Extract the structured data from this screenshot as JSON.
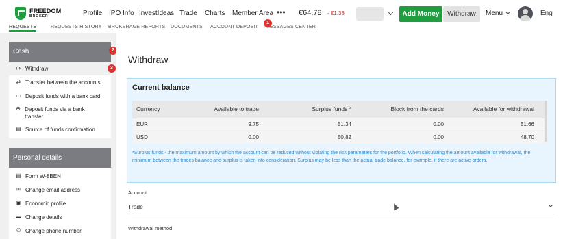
{
  "brand": {
    "name": "FREEDOM",
    "sub": "BROKER"
  },
  "nav": {
    "links": [
      "Profile",
      "IPO Info",
      "InvestIdeas",
      "Trade",
      "Charts",
      "Member Area"
    ],
    "more": "•••",
    "balance": "€64.78",
    "change": "- €1.38",
    "add_money": "Add Money",
    "withdraw": "Withdraw",
    "menu": "Menu",
    "lang": "Eng"
  },
  "badges": {
    "b1": "1",
    "b2": "2",
    "b3": "3"
  },
  "subtabs": [
    "REQUESTS",
    "REQUESTS HISTORY",
    "BROKERAGE REPORTS",
    "DOCUMENTS",
    "ACCOUNT DEPOSIT",
    "MESSAGES CENTER"
  ],
  "sidebar": {
    "cash": {
      "header": "Cash",
      "items": [
        {
          "label": "Withdraw",
          "icon": "withdraw-icon"
        },
        {
          "label": "Transfer between the accounts",
          "icon": "transfer-icon"
        },
        {
          "label": "Deposit funds with a bank card",
          "icon": "card-icon"
        },
        {
          "label": "Deposit funds via a bank transfer",
          "icon": "bank-transfer-icon"
        },
        {
          "label": "Source of funds confirmation",
          "icon": "document-icon"
        }
      ]
    },
    "personal": {
      "header": "Personal details",
      "items": [
        {
          "label": "Form W-8BEN",
          "icon": "form-icon"
        },
        {
          "label": "Change email address",
          "icon": "envelope-icon"
        },
        {
          "label": "Economic profile",
          "icon": "briefcase-icon"
        },
        {
          "label": "Change details",
          "icon": "folder-icon"
        },
        {
          "label": "Change phone number",
          "icon": "phone-icon"
        }
      ]
    }
  },
  "main": {
    "title": "Withdraw",
    "balance_box": {
      "title": "Current balance",
      "columns": [
        "Currency",
        "Available to trade",
        "Surplus funds *",
        "Block from the cards",
        "Available for withdrawal"
      ],
      "rows": [
        [
          "EUR",
          "9.75",
          "51.34",
          "0.00",
          "51.66"
        ],
        [
          "USD",
          "0.00",
          "50.82",
          "0.00",
          "48.70"
        ]
      ],
      "note": "*Surplus funds - the maximum amount by which the account can be reduced without violating the risk parameters for the portfolio. When calculating the amount available for withdrawal, the minimum between the trades balance and surplus is taken into consideration. Surplus may be less than the actual trade balance, for example, if there are active orders."
    },
    "account_label": "Account",
    "account_value": "Trade",
    "withdrawal_method_label": "Withdrawal method"
  },
  "colors": {
    "brand_green": "#1e9e3e",
    "badge_red": "#e0312e",
    "note_blue": "#2b8cd0",
    "sidebar_header": "#7a7c81"
  }
}
